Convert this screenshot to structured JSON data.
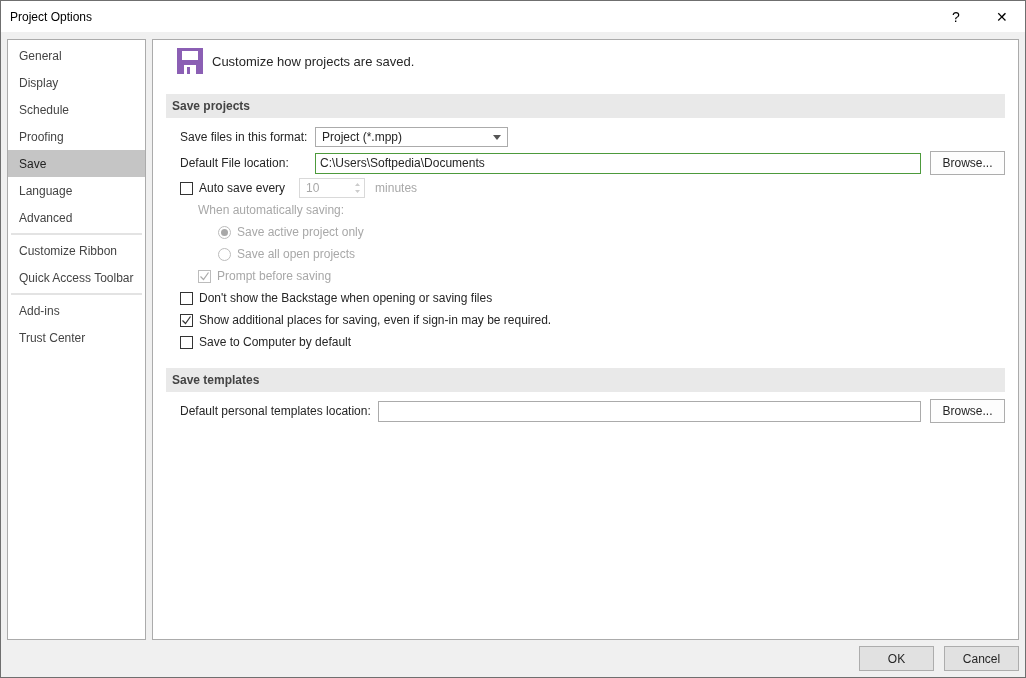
{
  "window": {
    "title": "Project Options",
    "help": "?",
    "close": "✕"
  },
  "sidebar": {
    "groups": [
      [
        {
          "label": "General",
          "selected": false
        },
        {
          "label": "Display",
          "selected": false
        },
        {
          "label": "Schedule",
          "selected": false
        },
        {
          "label": "Proofing",
          "selected": false
        },
        {
          "label": "Save",
          "selected": true
        },
        {
          "label": "Language",
          "selected": false
        },
        {
          "label": "Advanced",
          "selected": false
        }
      ],
      [
        {
          "label": "Customize Ribbon",
          "selected": false
        },
        {
          "label": "Quick Access Toolbar",
          "selected": false
        }
      ],
      [
        {
          "label": "Add-ins",
          "selected": false
        },
        {
          "label": "Trust Center",
          "selected": false
        }
      ]
    ]
  },
  "header": {
    "text": "Customize how projects are saved."
  },
  "sections": [
    {
      "title": "Save projects",
      "fields": [
        {
          "kind": "dropdown",
          "label": "Save files in this format:",
          "value": "Project (*.mpp)"
        },
        {
          "kind": "path",
          "label": "Default File location:",
          "value": "C:\\Users\\Softpedia\\Documents",
          "button": "Browse..."
        }
      ],
      "options": [
        {
          "kind": "spin",
          "label": "Auto save every",
          "checked": false,
          "disabled": false,
          "value": "10",
          "unit": "minutes",
          "children": [
            {
              "kind": "label",
              "label": "When automatically saving:",
              "disabled": true,
              "children": [
                {
                  "kind": "radio",
                  "label": "Save active project only",
                  "selected": true,
                  "disabled": true
                },
                {
                  "kind": "radio",
                  "label": "Save all open projects",
                  "selected": false,
                  "disabled": true
                }
              ]
            },
            {
              "kind": "checkbox",
              "label": "Prompt before saving",
              "checked": true,
              "disabled": true
            }
          ]
        },
        {
          "kind": "checkbox",
          "label": "Don't show the Backstage when opening or saving files",
          "checked": false,
          "disabled": false
        },
        {
          "kind": "checkbox",
          "label": "Show additional places for saving, even if sign-in may be required.",
          "checked": true,
          "disabled": false
        },
        {
          "kind": "checkbox",
          "label": "Save to Computer by default",
          "checked": false,
          "disabled": false
        }
      ]
    },
    {
      "title": "Save templates",
      "fields": [
        {
          "kind": "path",
          "label": "Default personal templates location:",
          "button": "Browse..."
        }
      ]
    }
  ],
  "footer": {
    "buttons": [
      "OK",
      "Cancel"
    ]
  }
}
